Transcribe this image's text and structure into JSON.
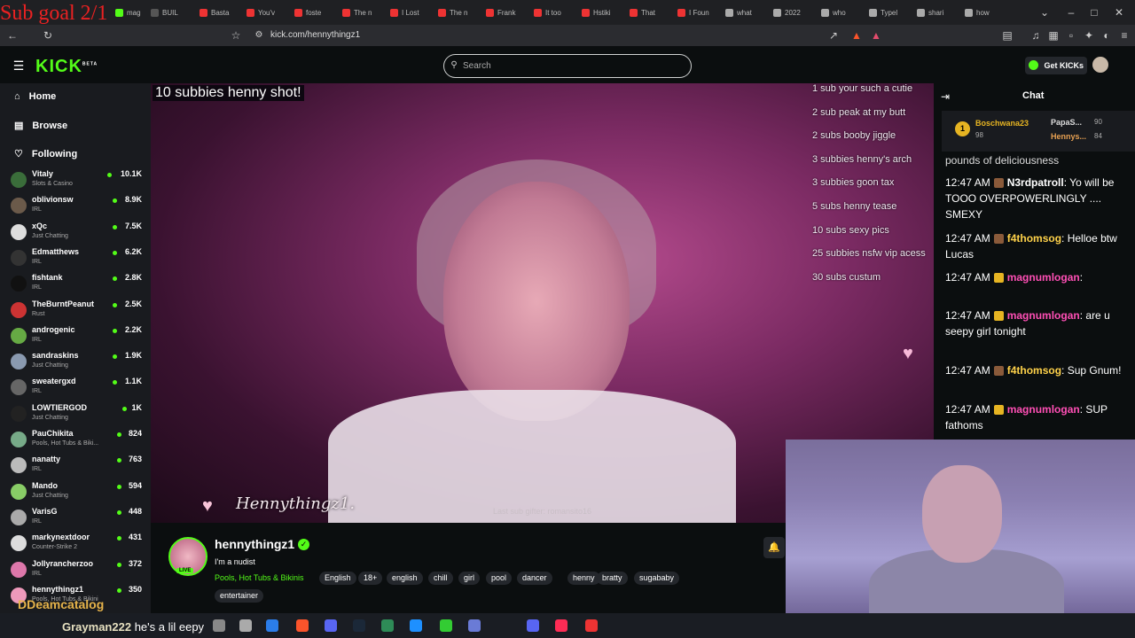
{
  "browser": {
    "tabs": [
      "mag",
      "BUIL",
      "Basta",
      "You'v",
      "foste",
      "The n",
      "I Lost",
      "The n",
      "Frank",
      "It too",
      "Hstiki",
      "That",
      "I Foun",
      "what",
      "2022",
      "who",
      "Typel",
      "shari",
      "how"
    ],
    "url": "kick.com/hennythingz1"
  },
  "overlay_top": "Sub goal 2/1",
  "kick": {
    "logo": "KICK",
    "logo_beta": "BETA",
    "search_placeholder": "Search",
    "get_kicks": "Get KICKs"
  },
  "sidebar": {
    "nav": [
      {
        "label": "Home",
        "icon": "home-icon"
      },
      {
        "label": "Browse",
        "icon": "browse-icon"
      },
      {
        "label": "Following",
        "icon": "heart-icon"
      }
    ],
    "channels": [
      {
        "name": "Vitaly",
        "category": "Slots & Casino",
        "viewers": "10.1K"
      },
      {
        "name": "oblivionsw",
        "category": "IRL",
        "viewers": "8.9K"
      },
      {
        "name": "xQc",
        "category": "Just Chatting",
        "viewers": "7.5K"
      },
      {
        "name": "Edmatthews",
        "category": "IRL",
        "viewers": "6.2K"
      },
      {
        "name": "fishtank",
        "category": "IRL",
        "viewers": "2.8K"
      },
      {
        "name": "TheBurntPeanut",
        "category": "Rust",
        "viewers": "2.5K"
      },
      {
        "name": "androgenic",
        "category": "IRL",
        "viewers": "2.2K"
      },
      {
        "name": "sandraskins",
        "category": "Just Chatting",
        "viewers": "1.9K"
      },
      {
        "name": "sweatergxd",
        "category": "IRL",
        "viewers": "1.1K"
      },
      {
        "name": "LOWTIERGOD",
        "category": "Just Chatting",
        "viewers": "1K"
      },
      {
        "name": "PauChikita",
        "category": "Pools, Hot Tubs & Biki...",
        "viewers": "824"
      },
      {
        "name": "nanatty",
        "category": "IRL",
        "viewers": "763"
      },
      {
        "name": "Mando",
        "category": "Just Chatting",
        "viewers": "594"
      },
      {
        "name": "VarisG",
        "category": "IRL",
        "viewers": "448"
      },
      {
        "name": "markynextdoor",
        "category": "Counter-Strike 2",
        "viewers": "431"
      },
      {
        "name": "Jollyrancherzoo",
        "category": "IRL",
        "viewers": "372"
      },
      {
        "name": "hennythingz1",
        "category": "Pools, Hot Tubs & Bikini",
        "viewers": "350"
      }
    ]
  },
  "video": {
    "overlay_title": "10 subbies henny shot!",
    "sub_goals": [
      "1 sub your such a cutie",
      "2 sub peak at my butt",
      "2 subs booby jiggle",
      "3 subbies henny's arch",
      "3 subbies goon tax",
      "5 subs henny tease",
      "10 subs sexy pics",
      "25 subbies nsfw vip acess",
      "30 subs custum"
    ],
    "signature": "Hennythingz1.",
    "last_sub": "Last sub gifter: romansito16"
  },
  "streamer": {
    "name": "hennythingz1",
    "live": "LIVE",
    "title": "I'm a nudist",
    "category": "Pools, Hot Tubs & Bikinis",
    "tags": [
      "English",
      "18+",
      "english",
      "chill",
      "girl",
      "pool",
      "dancer",
      "henny",
      "bratty",
      "sugababy",
      "entertainer"
    ]
  },
  "chat": {
    "title": "Chat",
    "leaderboard": [
      {
        "name": "Boschwana23",
        "value": "98"
      },
      {
        "name": "PapaS...",
        "value": "90"
      },
      {
        "name": "Hennys...",
        "value": "84"
      }
    ],
    "partial_top": "pounds of deliciousness",
    "messages": [
      {
        "time": "12:47 AM",
        "user": "N3rdpatroll",
        "color": "#ffffff",
        "text": "Yo will be TOOO OVERPOWERLINGLY .... SMEXY"
      },
      {
        "time": "12:47 AM",
        "user": "f4thomsog",
        "color": "#ffd24a",
        "text": "Helloe btw Lucas"
      },
      {
        "time": "12:47 AM",
        "user": "magnumlogan",
        "color": "#ff4fb5",
        "text": ""
      },
      {
        "time": "12:47 AM",
        "user": "magnumlogan",
        "color": "#ff4fb5",
        "text": "are u seepy girl tonight"
      },
      {
        "time": "12:47 AM",
        "user": "f4thomsog",
        "color": "#ffd24a",
        "text": "Sup Gnum!"
      },
      {
        "time": "12:47 AM",
        "user": "magnumlogan",
        "color": "#ff4fb5",
        "text": "SUP fathoms"
      }
    ]
  },
  "bottom_overlay": {
    "catalog": "DDeamcatalog",
    "grayman_user": "Grayman222",
    "grayman_text": "he's a lil eepy"
  }
}
